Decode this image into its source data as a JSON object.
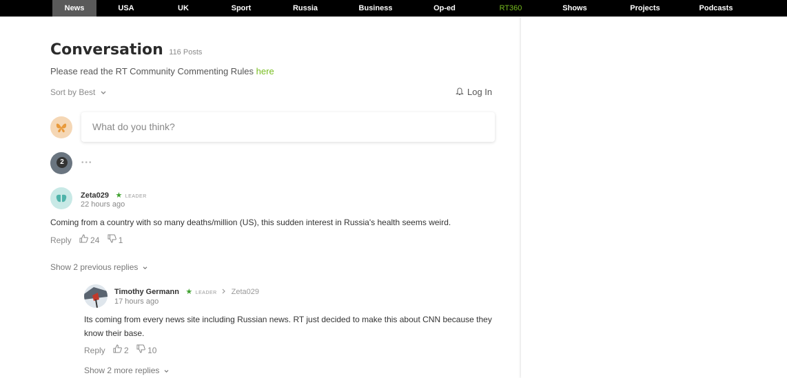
{
  "nav": {
    "items": [
      {
        "label": "News"
      },
      {
        "label": "USA"
      },
      {
        "label": "UK"
      },
      {
        "label": "Sport"
      },
      {
        "label": "Russia"
      },
      {
        "label": "Business"
      },
      {
        "label": "Op-ed"
      },
      {
        "label": "RT360"
      },
      {
        "label": "Shows"
      },
      {
        "label": "Projects"
      },
      {
        "label": "Podcasts"
      }
    ],
    "active_color": "#5a5a5a",
    "highlight_color": "#77bd1f"
  },
  "conversation": {
    "title": "Conversation",
    "count": "116 Posts",
    "rules_text": "Please read the RT Community Commenting Rules ",
    "rules_link": "here",
    "sort_label": "Sort by Best",
    "login_label": "Log In",
    "compose_placeholder": "What do you think?",
    "typing_count": "2",
    "typing_dots": "•••"
  },
  "comments": [
    {
      "username": "Zeta029",
      "badge": "LEADER",
      "time": "22 hours ago",
      "body": "Coming from a country with so many deaths/million (US), this sudden interest in Russia's health seems weird.",
      "reply_label": "Reply",
      "upvotes": "24",
      "downvotes": "1",
      "show_replies": "Show 2 previous replies"
    }
  ],
  "replies": [
    {
      "username": "Timothy Germann",
      "badge": "LEADER",
      "reply_to": "Zeta029",
      "time": "17 hours ago",
      "body": "Its coming from every news site including Russian news. RT just decided to make this about CNN because they know their base.",
      "reply_label": "Reply",
      "upvotes": "2",
      "downvotes": "10",
      "show_replies": "Show 2 more replies"
    }
  ],
  "icons": {
    "sort_chevron": "chevron-down-icon",
    "login_bell": "bell-icon",
    "upvote": "thumbs-up-icon",
    "downvote": "thumbs-down-icon",
    "leader_star": "star-icon",
    "reply_arrow": "chevron-right-icon"
  }
}
